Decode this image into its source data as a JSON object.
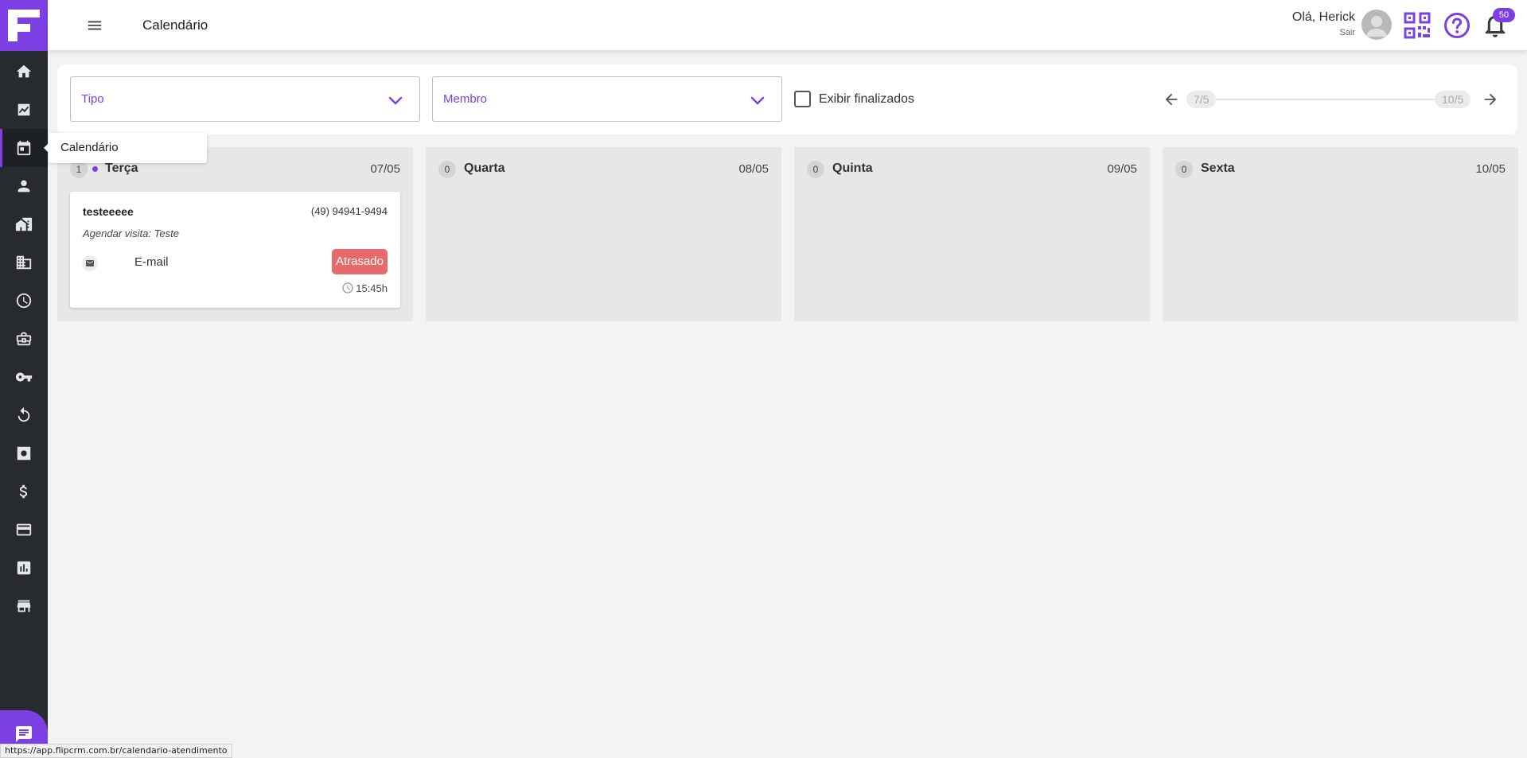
{
  "header": {
    "title": "Calendário",
    "greeting": "Olá, Herick",
    "logout": "Sair",
    "notification_count": "50"
  },
  "sidebar": {
    "items": [
      {
        "icon": "home-icon"
      },
      {
        "icon": "chart-line-icon"
      },
      {
        "icon": "calendar-icon",
        "active": true
      },
      {
        "icon": "person-icon"
      },
      {
        "icon": "house-building-icon"
      },
      {
        "icon": "building-icon"
      },
      {
        "icon": "clock-icon"
      },
      {
        "icon": "briefcase-icon"
      },
      {
        "icon": "key-icon"
      },
      {
        "icon": "refresh-icon"
      },
      {
        "icon": "gear-box-icon"
      },
      {
        "icon": "dollar-icon"
      },
      {
        "icon": "credit-card-icon"
      },
      {
        "icon": "bar-chart-icon"
      },
      {
        "icon": "store-icon"
      }
    ],
    "tooltip": "Calendário"
  },
  "filters": {
    "tipo_placeholder": "Tipo",
    "membro_placeholder": "Membro",
    "show_finished_label": "Exibir finalizados",
    "range_start": "7/5",
    "range_end": "10/5"
  },
  "days": [
    {
      "count": "1",
      "name": "Terça",
      "date": "07/05",
      "events": [
        {
          "name": "testeeeee",
          "phone": "(49) 94941-9494",
          "description": "Agendar visita: Teste",
          "channel": "E-mail",
          "status": "Atrasado",
          "time": "15:45h"
        }
      ]
    },
    {
      "count": "0",
      "name": "Quarta",
      "date": "08/05",
      "events": []
    },
    {
      "count": "0",
      "name": "Quinta",
      "date": "09/05",
      "events": []
    },
    {
      "count": "0",
      "name": "Sexta",
      "date": "10/05",
      "events": []
    }
  ],
  "status_bar_url": "https://app.flipcrm.com.br/calendario-atendimento",
  "colors": {
    "accent": "#7b3fe4",
    "sidebar": "#272b2f",
    "late": "#e66a6a"
  }
}
